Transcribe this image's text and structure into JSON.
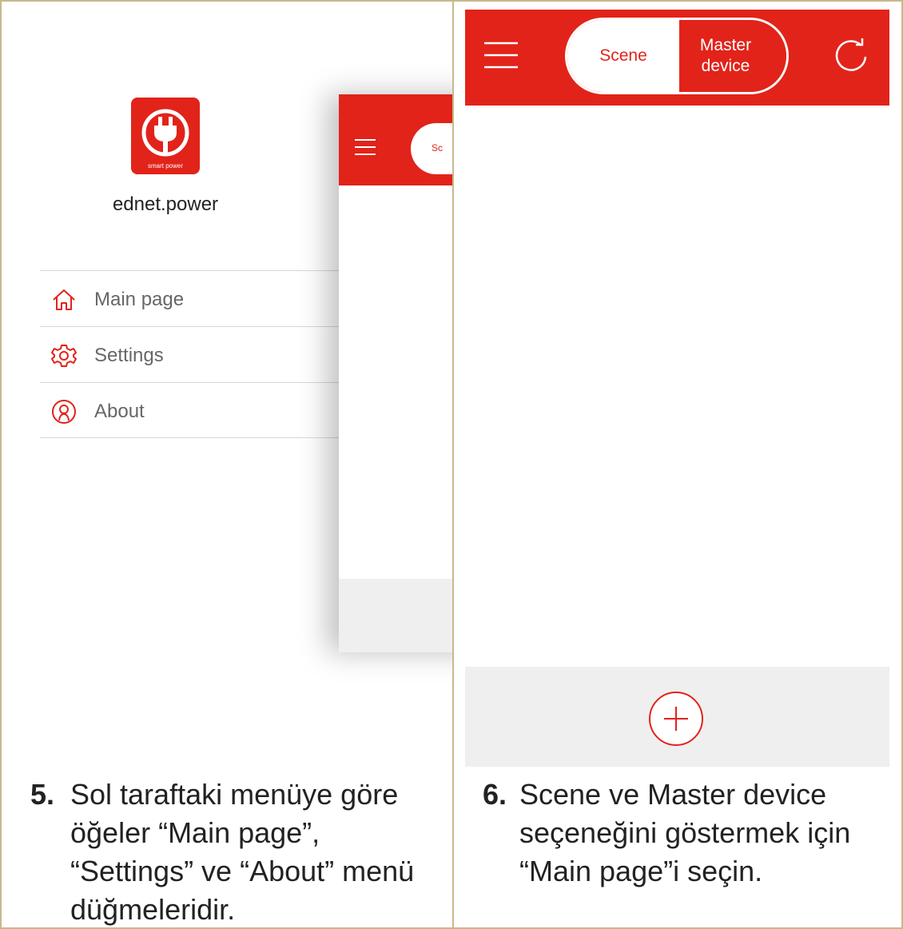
{
  "left_screen": {
    "logo_text": "smart power",
    "app_name": "ednet.power",
    "menu_items": [
      {
        "label": "Main page",
        "icon": "home-icon"
      },
      {
        "label": "Settings",
        "icon": "gear-icon"
      },
      {
        "label": "About",
        "icon": "user-icon"
      }
    ],
    "preview_tab_partial": "Sc"
  },
  "right_screen": {
    "tabs": {
      "scene": "Scene",
      "master_device": "Master device"
    },
    "icons": [
      "menu-icon",
      "refresh-icon",
      "add-icon"
    ]
  },
  "captions": [
    {
      "number": "5.",
      "text": "Sol taraftaki menüye göre öğeler “Main page”, “Settings” ve “About” menü düğmeleridir."
    },
    {
      "number": "6.",
      "text": "Scene ve Master device seçeneğini göstermek için “Main page”i seçin."
    }
  ],
  "colors": {
    "accent": "#e2231a",
    "border": "#c8b98a",
    "footer_bg": "#efefef"
  }
}
